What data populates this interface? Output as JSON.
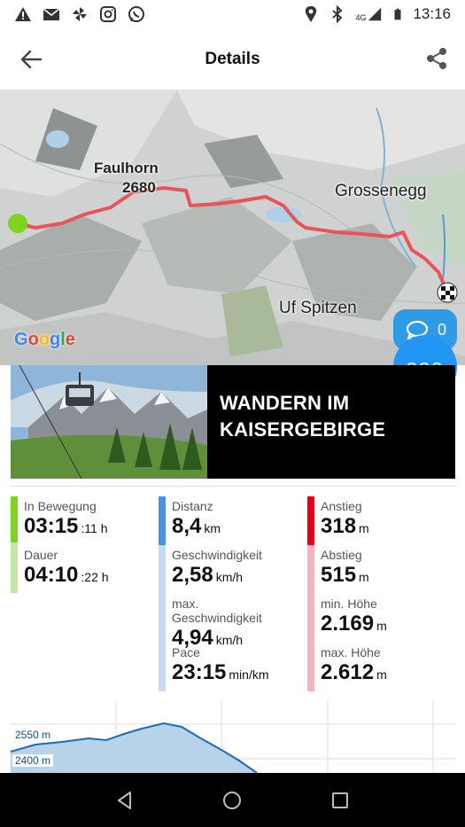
{
  "status_bar": {
    "time": "13:16",
    "network": "4G",
    "left_icons": [
      "warning-icon",
      "mail-icon",
      "pinwheel-icon",
      "instagram-icon",
      "whatsapp-icon"
    ],
    "right_icons": [
      "location-icon",
      "bluetooth-icon",
      "signal-icon",
      "battery-icon"
    ]
  },
  "header": {
    "title": "Details"
  },
  "map": {
    "labels": {
      "peak_name": "Faulhorn",
      "peak_height": "2680",
      "village": "Grossenegg",
      "spitzen": "Uf Spitzen"
    },
    "route_color": "#e8545a",
    "start_color": "#7ed321"
  },
  "comments": {
    "count": "0"
  },
  "more": {
    "label": "ooo"
  },
  "banner": {
    "line1": "WANDERN IM",
    "line2": "KAISERGEBIRGE"
  },
  "stats": {
    "moving": {
      "label": "In Bewegung",
      "value": "03:15",
      "unit": ":11 h"
    },
    "duration": {
      "label": "Dauer",
      "value": "04:10",
      "unit": ":22 h"
    },
    "distance": {
      "label": "Distanz",
      "value": "8,4",
      "unit": "km"
    },
    "speed": {
      "label": "Geschwindigkeit",
      "value": "2,58",
      "unit": "km/h"
    },
    "max_speed": {
      "label": "max. Geschwindigkeit",
      "value": "4,94",
      "unit": "km/h"
    },
    "pace": {
      "label": "Pace",
      "value": "23:15",
      "unit": "min/km"
    },
    "ascent": {
      "label": "Anstieg",
      "value": "318",
      "unit": "m"
    },
    "descent": {
      "label": "Abstieg",
      "value": "515",
      "unit": "m"
    },
    "min_height": {
      "label": "min. Höhe",
      "value": "2.169",
      "unit": "m"
    },
    "max_height": {
      "label": "max. Höhe",
      "value": "2.612",
      "unit": "m"
    }
  },
  "colors": {
    "time": "#7ed321",
    "time_light": "#c5e6a6",
    "distance": "#4a90e2",
    "distance_light": "#c7dcf3",
    "altitude": "#e0001b",
    "altitude_light": "#f5b3ba"
  },
  "elevation": {
    "tick_high": "2550 m",
    "tick_low": "2400 m"
  }
}
